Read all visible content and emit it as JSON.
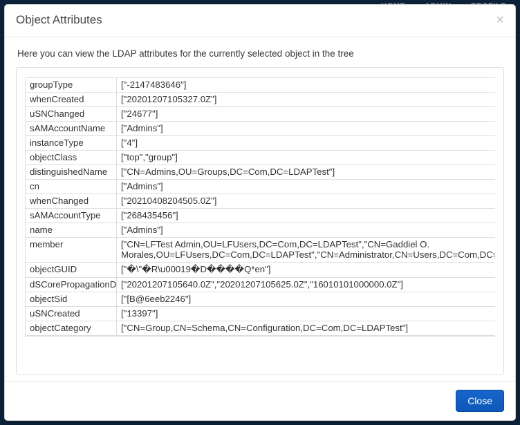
{
  "nav": {
    "home": "HOME",
    "admin": "ADMIN",
    "profile": "PROFILE"
  },
  "modal": {
    "title": "Object Attributes",
    "close_x": "×",
    "description": "Here you can view the LDAP attributes for the currently selected object in the tree",
    "close_button": "Close"
  },
  "attributes": [
    {
      "key": "groupType",
      "value": "[\"-2147483646\"]"
    },
    {
      "key": "whenCreated",
      "value": "[\"20201207105327.0Z\"]"
    },
    {
      "key": "uSNChanged",
      "value": "[\"24677\"]"
    },
    {
      "key": "sAMAccountName",
      "value": "[\"Admins\"]"
    },
    {
      "key": "instanceType",
      "value": "[\"4\"]"
    },
    {
      "key": "objectClass",
      "value": "[\"top\",\"group\"]"
    },
    {
      "key": "distinguishedName",
      "value": "[\"CN=Admins,OU=Groups,DC=Com,DC=LDAPTest\"]"
    },
    {
      "key": "cn",
      "value": "[\"Admins\"]"
    },
    {
      "key": "whenChanged",
      "value": "[\"20210408204505.0Z\"]"
    },
    {
      "key": "sAMAccountType",
      "value": "[\"268435456\"]"
    },
    {
      "key": "name",
      "value": "[\"Admins\"]"
    },
    {
      "key": "member",
      "value": "[\"CN=LFTest Admin,OU=LFUsers,DC=Com,DC=LDAPTest\",\"CN=Gaddiel O. Morales,OU=LFUsers,DC=Com,DC=LDAPTest\",\"CN=Administrator,CN=Users,DC=Com,DC=LDAPTest\"]",
      "wrap": true
    },
    {
      "key": "objectGUID",
      "value": "[\"�\\\"�R\\u00019�D����Q*en\"]"
    },
    {
      "key": "dSCorePropagationData",
      "value": "[\"20201207105640.0Z\",\"20201207105625.0Z\",\"16010101000000.0Z\"]"
    },
    {
      "key": "objectSid",
      "value": "[\"[B@6eeb2246\"]"
    },
    {
      "key": "uSNCreated",
      "value": "[\"13397\"]"
    },
    {
      "key": "objectCategory",
      "value": "[\"CN=Group,CN=Schema,CN=Configuration,DC=Com,DC=LDAPTest\"]"
    }
  ]
}
